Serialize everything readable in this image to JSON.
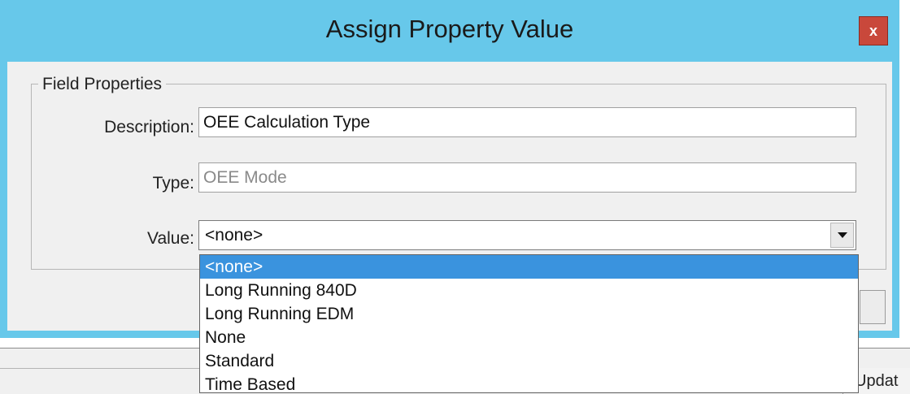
{
  "window": {
    "title": "Assign Property Value",
    "close_glyph": "x"
  },
  "group": {
    "label": "Field Properties"
  },
  "fields": {
    "description": {
      "label": "Description:",
      "value": "OEE Calculation Type"
    },
    "type": {
      "label": "Type:",
      "value": "OEE Mode"
    },
    "value": {
      "label": "Value:",
      "selected": "<none>"
    }
  },
  "dropdown": {
    "options": [
      "<none>",
      "Long Running 840D",
      "Long Running EDM",
      "None",
      "Standard",
      "Time Based"
    ],
    "highlighted_index": 0
  },
  "background": {
    "partial_button_label": "Updat"
  },
  "colors": {
    "title_bar": "#67c8ea",
    "close_button": "#c9483b",
    "selection": "#3a93de"
  },
  "icons": {
    "close": "close-icon",
    "combo_arrow": "chevron-down-icon"
  }
}
